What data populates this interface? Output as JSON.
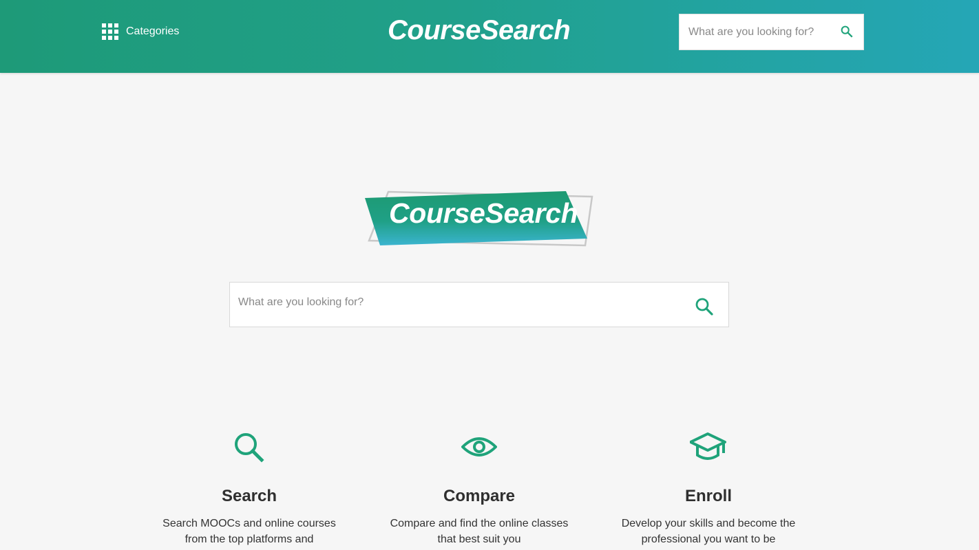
{
  "header": {
    "categories_label": "Categories",
    "brand": "CourseSearch",
    "search_placeholder": "What are you looking for?"
  },
  "hero": {
    "logo_text": "CourseSearch",
    "search_placeholder": "What are you looking for?"
  },
  "features": [
    {
      "title": "Search",
      "icon": "search-icon",
      "text": "Search MOOCs and online courses from the top platforms and"
    },
    {
      "title": "Compare",
      "icon": "eye-icon",
      "text": "Compare and find the online classes that best suit you"
    },
    {
      "title": "Enroll",
      "icon": "graduation-cap-icon",
      "text": "Develop your skills and become the professional you want to be"
    }
  ],
  "colors": {
    "accent": "#1fa37a",
    "header_start": "#1e9a78",
    "header_end": "#25a6b6"
  }
}
